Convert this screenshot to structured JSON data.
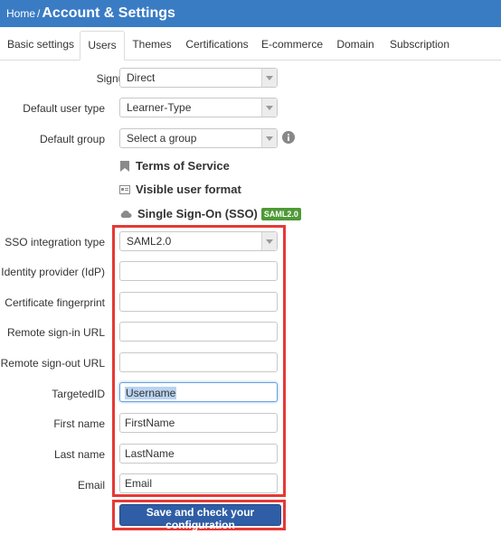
{
  "header": {
    "home_label": "Home",
    "separator": "/",
    "title": "Account & Settings"
  },
  "tabs": [
    {
      "label": "Basic settings",
      "active": false
    },
    {
      "label": "Users",
      "active": true
    },
    {
      "label": "Themes",
      "active": false
    },
    {
      "label": "Certifications",
      "active": false
    },
    {
      "label": "E-commerce",
      "active": false
    },
    {
      "label": "Domain",
      "active": false
    },
    {
      "label": "Subscription",
      "active": false
    }
  ],
  "form": {
    "signup": {
      "label": "Signup",
      "value": "Direct"
    },
    "default_user_type": {
      "label": "Default user type",
      "value": "Learner-Type"
    },
    "default_group": {
      "label": "Default group",
      "value": "Select a group"
    }
  },
  "sections": {
    "terms": {
      "label": "Terms of Service",
      "icon": "bookmark-icon"
    },
    "visible_format": {
      "label": "Visible user format",
      "icon": "id-card-icon"
    },
    "sso": {
      "label": "Single Sign-On (SSO)",
      "icon": "cloud-icon",
      "badge": "SAML2.0"
    }
  },
  "sso": {
    "integration_type": {
      "label": "SSO integration type",
      "value": "SAML2.0"
    },
    "idp": {
      "label": "Identity provider (IdP)",
      "value": ""
    },
    "fingerprint": {
      "label": "Certificate fingerprint",
      "value": ""
    },
    "signin_url": {
      "label": "Remote sign-in URL",
      "value": ""
    },
    "signout_url": {
      "label": "Remote sign-out URL",
      "value": ""
    },
    "targeted_id": {
      "label": "TargetedID",
      "value": "Username"
    },
    "first_name": {
      "label": "First name",
      "value": "FirstName"
    },
    "last_name": {
      "label": "Last name",
      "value": "LastName"
    },
    "email": {
      "label": "Email",
      "value": "Email"
    }
  },
  "actions": {
    "save_label": "Save and check your configuration"
  },
  "colors": {
    "header_bg": "#3a7cc4",
    "highlight": "#e53935",
    "button_bg": "#2f5ea6",
    "badge_bg": "#4e9a37"
  }
}
